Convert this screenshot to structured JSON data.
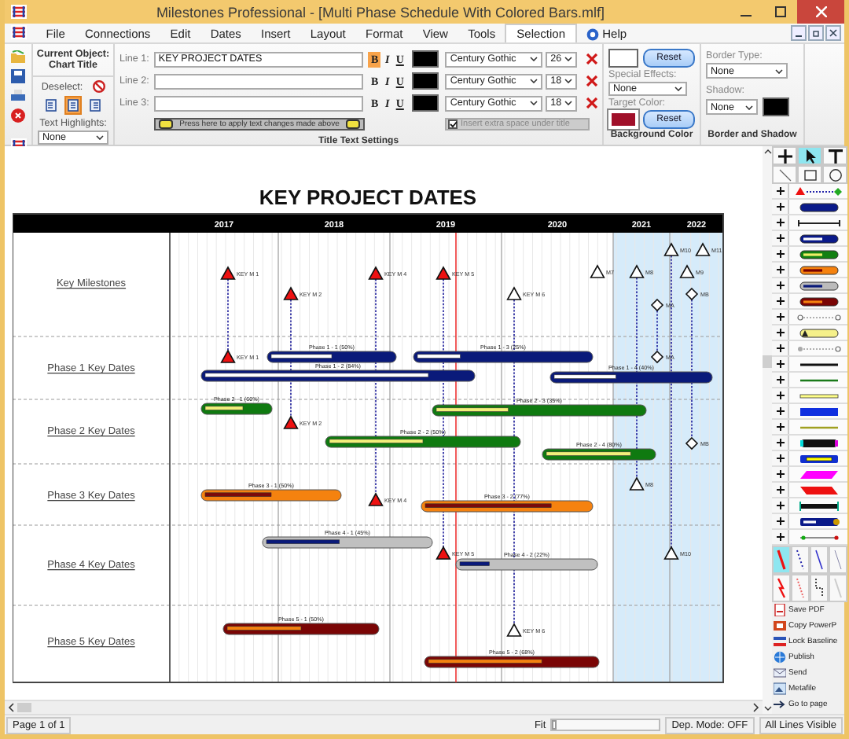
{
  "window": {
    "title": "Milestones Professional - [Multi Phase Schedule With Colored Bars.mlf]"
  },
  "menu": [
    {
      "label": "File",
      "kind": "plain",
      "selected": false
    },
    {
      "label": "Connections",
      "kind": "plain",
      "selected": false
    },
    {
      "label": "Edit",
      "kind": "plain",
      "selected": false
    },
    {
      "label": "Dates",
      "kind": "plain",
      "selected": false
    },
    {
      "label": "Insert",
      "kind": "plain",
      "selected": false
    },
    {
      "label": "Layout",
      "kind": "plain",
      "selected": false
    },
    {
      "label": "Format",
      "kind": "plain",
      "selected": false
    },
    {
      "label": "View",
      "kind": "plain",
      "selected": false
    },
    {
      "label": "Tools",
      "kind": "plain",
      "selected": false
    },
    {
      "label": "Selection",
      "kind": "plain",
      "selected": true
    },
    {
      "label": "Help",
      "kind": "help",
      "selected": false
    }
  ],
  "ribbon": {
    "current_object": {
      "heading": "Current Object:",
      "value": "Chart Title"
    },
    "deselect": {
      "label": "Deselect:"
    },
    "alignment": [
      {
        "selected": false
      },
      {
        "selected": true
      },
      {
        "selected": false
      }
    ],
    "text_highlights": {
      "label": "Text Highlights:",
      "value": "None"
    },
    "title_text": {
      "group_label": "Title Text Settings",
      "lines": [
        {
          "label": "Line 1:",
          "value": "KEY PROJECT DATES",
          "styles": [
            {
              "text": "B",
              "selected": true
            },
            {
              "text": "I",
              "selected": false
            },
            {
              "text": "U",
              "selected": false
            }
          ],
          "color": "#000000",
          "font": "Century Gothic",
          "size": "26"
        },
        {
          "label": "Line 2:",
          "styles": [
            {
              "text": "B",
              "selected": false
            },
            {
              "text": "I",
              "selected": false
            },
            {
              "text": "U",
              "selected": false
            }
          ],
          "color": "#000000",
          "font": "Century Gothic",
          "size": "18"
        },
        {
          "label": "Line 3:",
          "styles": [
            {
              "text": "B",
              "selected": false
            },
            {
              "text": "I",
              "selected": false
            },
            {
              "text": "U",
              "selected": false
            }
          ],
          "color": "#000000",
          "font": "Century Gothic",
          "size": "18"
        }
      ],
      "apply_button": "Press here to apply text changes made above",
      "extra_space": {
        "label": "Insert extra space under title",
        "checked": true,
        "disabled": true
      }
    },
    "background_color": {
      "group_label": "Background Color",
      "color": "#ffffff",
      "reset": "Reset",
      "special_effects": {
        "label": "Special Effects:",
        "value": "None"
      },
      "target_color": {
        "label": "Target Color:",
        "color": "#a0102a",
        "reset": "Reset"
      }
    },
    "border_shadow": {
      "group_label": "Border and Shadow",
      "border_type": {
        "label": "Border Type:",
        "value": "None"
      },
      "shadow": {
        "label": "Shadow:",
        "value": "None",
        "color": "#000000"
      }
    }
  },
  "chart": {
    "title": "KEY PROJECT DATES",
    "years": [
      "2017",
      "2018",
      "2019",
      "2020",
      "2021",
      "2022"
    ],
    "rows": [
      {
        "label": "Key Milestones",
        "milestones": [
          {
            "label": "KEY M 1",
            "kind": "critical"
          },
          {
            "label": "KEY M 2",
            "kind": "critical"
          },
          {
            "label": "KEY M 4",
            "kind": "critical"
          },
          {
            "label": "KEY M 5",
            "kind": "critical"
          },
          {
            "label": "KEY M 6",
            "kind": "open"
          },
          {
            "label": "M7",
            "kind": "open"
          },
          {
            "label": "M8",
            "kind": "open"
          },
          {
            "label": "M9",
            "kind": "open"
          },
          {
            "label": "M10",
            "kind": "open"
          },
          {
            "label": "M11",
            "kind": "open"
          },
          {
            "label": "MA",
            "kind": "diamond"
          },
          {
            "label": "MB",
            "kind": "diamond"
          }
        ]
      },
      {
        "label": "Phase 1 Key Dates",
        "milestones": [
          {
            "label": "KEY M 1",
            "kind": "critical"
          },
          {
            "label": "MA",
            "kind": "diamond"
          }
        ],
        "bars": [
          {
            "label": "Phase 1 - 1 (50%)",
            "color": "#0a1a7a",
            "progress": {
              "level": 0.5,
              "color": "#ffffff"
            }
          },
          {
            "label": "Phase 1 - 2 (84%)",
            "color": "#0a1a7a",
            "progress": {
              "level": 0.84,
              "color": "#ffffff"
            }
          },
          {
            "label": "Phase 1 - 3 (25%)",
            "color": "#0a1a7a",
            "progress": {
              "level": 0.25,
              "color": "#ffffff"
            }
          },
          {
            "label": "Phase 1 - 4 (40%)",
            "color": "#0a1a7a",
            "progress": {
              "level": 0.4,
              "color": "#ffffff"
            }
          }
        ]
      },
      {
        "label": "Phase 2 Key Dates",
        "milestones": [
          {
            "label": "KEY M 2",
            "kind": "critical"
          },
          {
            "label": "MB",
            "kind": "diamond"
          }
        ],
        "bars": [
          {
            "label": "Phase 2 - 1 (60%)",
            "color": "#0f7a10",
            "progress": {
              "level": 0.6,
              "color": "#f2f07a"
            }
          },
          {
            "label": "Phase 2 - 2 (50%)",
            "color": "#0f7a10",
            "progress": {
              "level": 0.5,
              "color": "#f2f07a"
            }
          },
          {
            "label": "Phase 2 - 3 (35%)",
            "color": "#0f7a10",
            "progress": {
              "level": 0.35,
              "color": "#f2f07a"
            }
          },
          {
            "label": "Phase 2 - 4 (80%)",
            "color": "#0f7a10",
            "progress": {
              "level": 0.8,
              "color": "#f2f07a"
            }
          }
        ]
      },
      {
        "label": "Phase 3 Key Dates",
        "milestones": [
          {
            "label": "KEY M 4",
            "kind": "critical"
          },
          {
            "label": "M8",
            "kind": "open"
          }
        ],
        "bars": [
          {
            "label": "Phase 3 - 1 (50%)",
            "color": "#f5820f",
            "progress": {
              "level": 0.5,
              "color": "#7a0a0a"
            }
          },
          {
            "label": "Phase 3 - 2 (77%)",
            "color": "#f5820f",
            "progress": {
              "level": 0.77,
              "color": "#7a0a0a"
            }
          }
        ]
      },
      {
        "label": "Phase 4 Key Dates",
        "milestones": [
          {
            "label": "KEY M 5",
            "kind": "critical"
          },
          {
            "label": "M10",
            "kind": "open"
          }
        ],
        "bars": [
          {
            "label": "Phase 4 - 1 (45%)",
            "color": "#c0c0c0",
            "progress": {
              "level": 0.45,
              "color": "#0a1a7a"
            }
          },
          {
            "label": "Phase 4 - 2 (22%)",
            "color": "#c0c0c0",
            "progress": {
              "level": 0.22,
              "color": "#0a1a7a"
            }
          }
        ]
      },
      {
        "label": "Phase 5 Key Dates",
        "milestones": [
          {
            "label": "KEY M 6",
            "kind": "open"
          }
        ],
        "bars": [
          {
            "label": "Phase 5 - 1 (50%)",
            "color": "#7a0505",
            "progress": {
              "level": 0.5,
              "color": "#f5820f"
            }
          },
          {
            "label": "Phase 5 - 2 (68%)",
            "color": "#7a0505",
            "progress": {
              "level": 0.68,
              "color": "#f5820f"
            }
          }
        ]
      }
    ]
  },
  "toolbox": {
    "actions": [
      {
        "label": "Save PDF"
      },
      {
        "label": "Copy PowerP"
      },
      {
        "label": "Lock Baseline"
      },
      {
        "label": "Publish"
      },
      {
        "label": "Send"
      },
      {
        "label": "Metafile"
      },
      {
        "label": "Go to page"
      }
    ]
  },
  "status_bar": {
    "page": "Page 1 of 1",
    "fit_label": "Fit",
    "zoom": {
      "level": 0
    },
    "dep_mode": "Dep. Mode: OFF",
    "lines": "All Lines Visible"
  }
}
